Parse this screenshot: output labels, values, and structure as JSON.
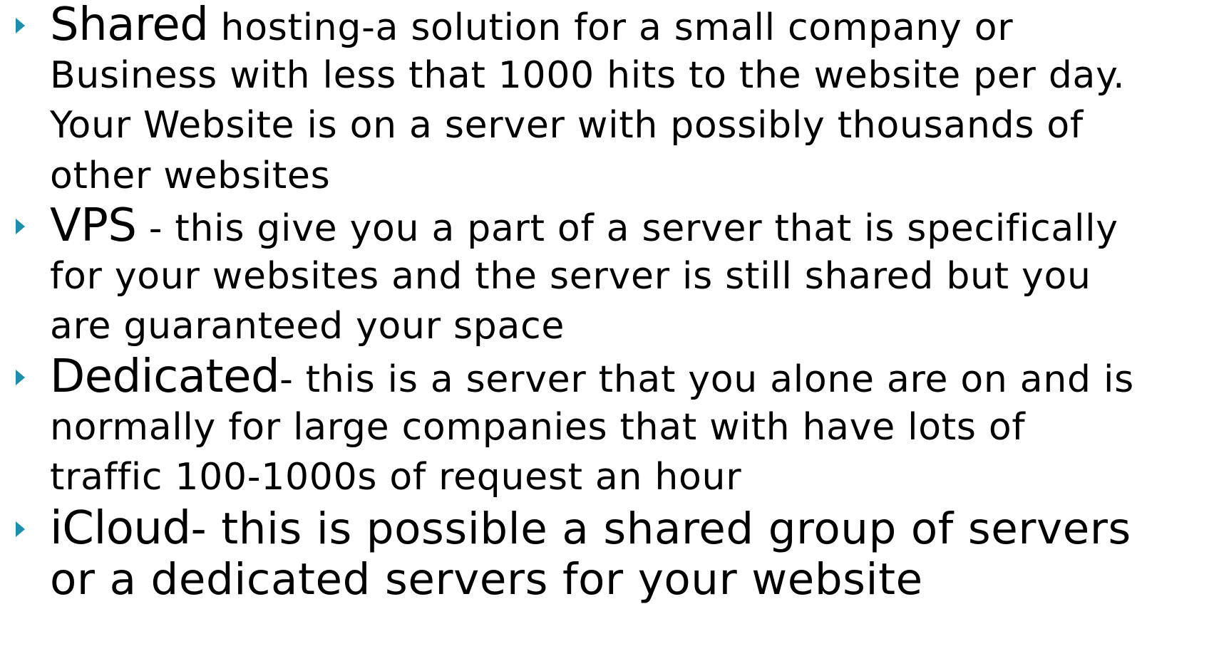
{
  "bullet_color": "#1a8fb0",
  "bullets": [
    {
      "term": "Shared",
      "lines": [
        " hosting-a solution for a small company or",
        "Business with less that 1000 hits to the website per day.",
        "Your Website is on a server with possibly thousands of",
        "other websites"
      ]
    },
    {
      "term": "VPS",
      "lines": [
        " - this give you a part of a server that is specifically",
        "for your websites and the server is still shared but you",
        "are guaranteed your space"
      ]
    },
    {
      "term": "Dedicated",
      "lines": [
        "- this is a server that you alone are on and is",
        "normally for large companies that with have lots of",
        "traffic 100-1000s of request an hour"
      ]
    },
    {
      "term": "iCloud",
      "lines": [
        "- this is possible a shared group of servers",
        "or a dedicated servers for your website"
      ]
    }
  ]
}
